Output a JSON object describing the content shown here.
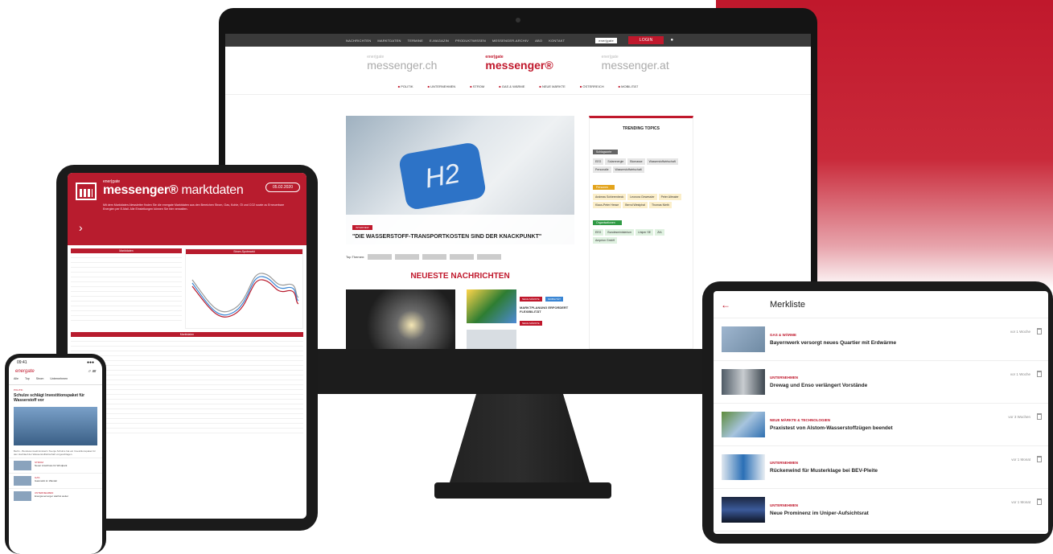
{
  "imac": {
    "topnav": [
      "NACHRICHTEN",
      "MARKTDATEN",
      "TERMINE",
      "E-MAGAZIN",
      "PRODUKTWISSEN",
      "MESSENGER-ARCHIV",
      "ABO",
      "KONTAKT"
    ],
    "mini_logo": "ener|gate",
    "login_label": "LOGIN",
    "brands": [
      {
        "top": "ener|gate",
        "name": "messenger.ch"
      },
      {
        "top": "ener|gate",
        "name": "messenger®"
      },
      {
        "top": "ener|gate",
        "name": "messenger.at"
      }
    ],
    "nav": [
      "POLITIK",
      "UNTERNEHMEN",
      "STROM",
      "GAS & WÄRME",
      "NEUE MÄRKTE",
      "ÖSTERREICH",
      "MOBILITÄT"
    ],
    "hero_tag": "INTERVIEW",
    "hero_title": "\"DIE WASSERSTOFF-TRANSPORTKOSTEN SIND DER KNACKPUNKT\"",
    "hero_cap_text": "H2",
    "top_themen_label": "Top Themen:",
    "neueste_a": "NEUESTE",
    "neueste_b": " NACHRICHTEN",
    "news_tag1": "NEUE MÄRKTE",
    "news_tag2": "MOBILITÄT",
    "news_title": "MARKTPLANUNG ERFORDERT FLEXIBILITÄT",
    "news_tag3": "NEUE MÄRKTE",
    "sidebar": {
      "title": "TRENDING TOPICS",
      "groups": [
        {
          "label": "Schlagworte",
          "color": "gray",
          "chips": [
            "EEG",
            "Solarenergie",
            "Biomasse",
            "Wasserstoffwirtschaft",
            "Personalie",
            "Wasserstoffwirtschaft"
          ]
        },
        {
          "label": "Personen",
          "color": "yellow",
          "chips": [
            "Andreas Schierenbeck",
            "Leonora Gewessler",
            "Peter Altmaier",
            "Klaus-Peter Hesse",
            "Bernd Westphal",
            "Thomas Nieth"
          ]
        },
        {
          "label": "Organisationen",
          "color": "green",
          "chips": [
            "EEG",
            "Bundesministerium",
            "Uniper SE",
            "ZIA",
            "Amprion GmbH"
          ]
        }
      ]
    }
  },
  "marktdaten": {
    "brand_top": "ener|gate",
    "title_bold": "messenger®",
    "title_light": "marktdaten",
    "date": "05.02.2020",
    "text": "Mit dem Marktdaten-Newsletter finden Sie die energate Marktdaten aus den Bereichen Strom, Gas, Kohle, Öl und CO2 sowie zu Erneuerbare Energien per E-Mail. Alle Einstellungen können Sie hier verwalten.",
    "table_header": "Marktdaten",
    "chart_header": "Strom-Spotmarkt",
    "long_header": "Marktdaten",
    "arrow": "›"
  },
  "phone": {
    "time": "09:41",
    "signal": "●●●",
    "logo": "energate",
    "logo_icons": "⌕ ☰",
    "tabs": [
      "Alle",
      "Top",
      "Strom",
      "Unternehmen"
    ],
    "kicker": "POLITIK",
    "headline": "Schulze schlägt Investitionspaket für Wasserstoff vor",
    "body": "Berlin - Bundesumweltministerin Svenja Schulze hat ein Investitionspaket für den Hochlauf der Wasserstoffwirtschaft vorgeschlagen.",
    "items": [
      {
        "cat": "STROM",
        "title": "Neuer Anschluss für Windpark"
      },
      {
        "cat": "GAS",
        "title": "Gasmarkt im Wandel"
      },
      {
        "cat": "UNTERNEHMEN",
        "title": "Energieversorger wächst weiter"
      }
    ]
  },
  "merkliste": {
    "title": "Merkliste",
    "back": "←",
    "items": [
      {
        "cat": "GAS & WÄRME",
        "title": "Bayernwerk versorgt neues Quartier mit Erdwärme",
        "time": "vor 1 Woche"
      },
      {
        "cat": "UNTERNEHMEN",
        "title": "Drewag und Enso verlängert Vorstände",
        "time": "vor 1 Woche"
      },
      {
        "cat": "NEUE MÄRKTE & TECHNOLOGIEN",
        "title": "Praxistest von Alstom-Wasserstoffzügen beendet",
        "time": "vor 3 Wochen"
      },
      {
        "cat": "UNTERNEHMEN",
        "title": "Rückenwind für Musterklage bei BEV-Pleite",
        "time": "vor 1 Monat"
      },
      {
        "cat": "UNTERNEHMEN",
        "title": "Neue Prominenz im Uniper-Aufsichtsrat",
        "time": "vor 1 Monat"
      }
    ]
  }
}
